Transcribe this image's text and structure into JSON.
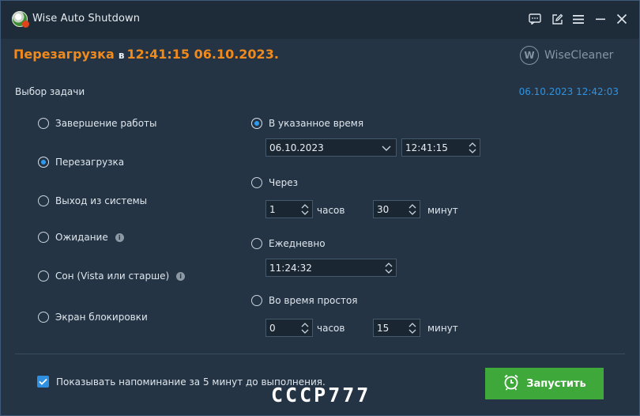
{
  "window": {
    "title": "Wise Auto Shutdown",
    "icon": "wise-auto-shutdown-icon"
  },
  "titlebar_buttons": [
    "feedback-icon",
    "edit-icon",
    "menu-icon",
    "minimize-icon",
    "close-icon"
  ],
  "header": {
    "action": "Перезагрузка",
    "connector": "в",
    "scheduled_time": "12:41:15 06.10.2023",
    "period": ".",
    "brand_logo": "W",
    "brand_name": "WiseCleaner"
  },
  "task_section": {
    "title": "Выбор задачи",
    "current_datetime": "06.10.2023 12:42:03"
  },
  "tasks": [
    {
      "label": "Завершение работы",
      "checked": false,
      "info": false
    },
    {
      "label": "Перезагрузка",
      "checked": true,
      "info": false
    },
    {
      "label": "Выход из системы",
      "checked": false,
      "info": false
    },
    {
      "label": "Ожидание",
      "checked": false,
      "info": true
    },
    {
      "label": "Сон (Vista или старше)",
      "checked": false,
      "info": true
    },
    {
      "label": "Экран блокировки",
      "checked": false,
      "info": false
    }
  ],
  "timing": {
    "at_time": {
      "label": "В указанное время",
      "checked": true,
      "date": "06.10.2023",
      "time": "12:41:15"
    },
    "after": {
      "label": "Через",
      "checked": false,
      "hours": "1",
      "hours_unit": "часов",
      "minutes": "30",
      "minutes_unit": "минут"
    },
    "daily": {
      "label": "Ежедневно",
      "checked": false,
      "time": "11:24:32"
    },
    "idle": {
      "label": "Во время простоя",
      "checked": false,
      "hours": "0",
      "hours_unit": "часов",
      "minutes": "15",
      "minutes_unit": "минут"
    }
  },
  "reminder": {
    "label": "Показывать напоминание за 5 минут до выполнения.",
    "checked": true
  },
  "start_button": {
    "label": "Запустить",
    "icon": "alarm-clock-icon"
  },
  "watermark": "CCCP777",
  "colors": {
    "accent_orange": "#f08a1c",
    "accent_blue": "#2f93e0",
    "start_green": "#3ea83a",
    "background": "#243444",
    "titlebar": "#1e2b38"
  }
}
